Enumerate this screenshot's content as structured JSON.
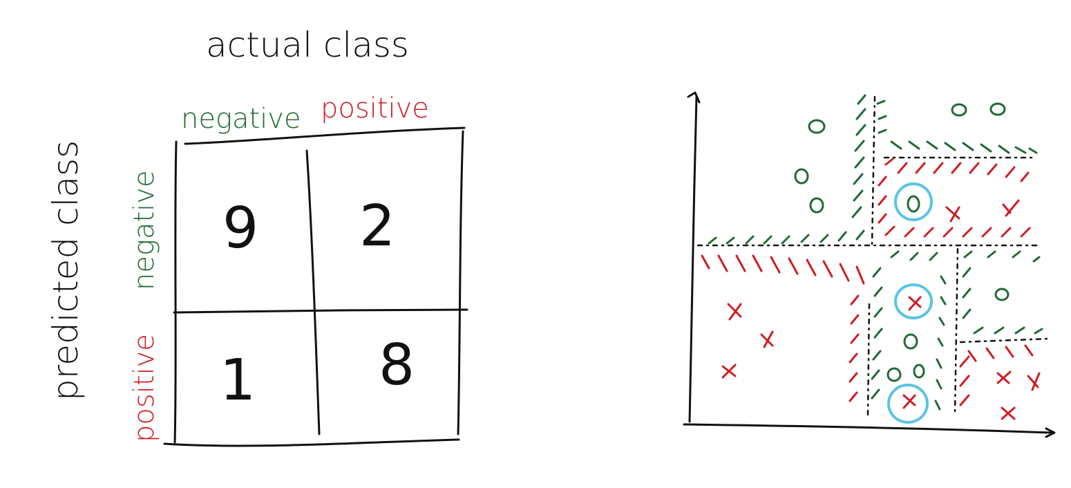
{
  "confusion_matrix": {
    "column_axis_title": "actual class",
    "row_axis_title": "predicted class",
    "column_labels": [
      "negative",
      "positive"
    ],
    "row_labels": [
      "negative",
      "positive"
    ],
    "cells": [
      [
        "9",
        "2"
      ],
      [
        "1",
        "8"
      ]
    ],
    "colors": {
      "negative": "#1f6a33",
      "positive": "#cf1c23",
      "ink": "#111111"
    }
  },
  "decision_regions": {
    "marker_legend": {
      "o": "negative",
      "x": "positive"
    },
    "highlight_color": "#5bc3e6"
  }
}
